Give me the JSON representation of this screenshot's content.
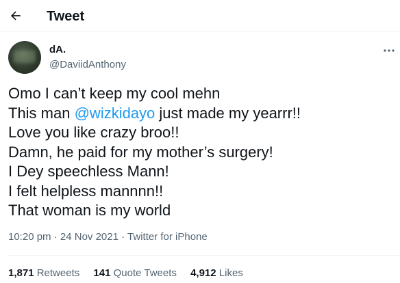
{
  "header": {
    "back_icon": "arrow-left-icon",
    "title": "Tweet"
  },
  "author": {
    "display_name": "dA.",
    "handle": "@DaviidAnthony",
    "more_icon": "more-horizontal-icon"
  },
  "tweet": {
    "lines": [
      {
        "before": "Omo I can’t keep my cool mehn"
      },
      {
        "before": "This man ",
        "mention": "@wizkidayo",
        "after": " just made my yearrr!!"
      },
      {
        "before": "Love you like crazy broo!!"
      },
      {
        "before": "Damn, he paid for my mother’s surgery!"
      },
      {
        "before": "I Dey speechless Mann!"
      },
      {
        "before": "I felt helpless mannnn!!"
      },
      {
        "before": "That woman is my world"
      }
    ]
  },
  "meta": {
    "time": "10:20 pm",
    "separator": "·",
    "date": "24 Nov 2021",
    "source": "Twitter for iPhone"
  },
  "stats": {
    "retweets_count": "1,871",
    "retweets_label": "Retweets",
    "quotes_count": "141",
    "quotes_label": "Quote Tweets",
    "likes_count": "4,912",
    "likes_label": "Likes"
  },
  "colors": {
    "accent": "#1d9bf0",
    "secondary_text": "#536471",
    "primary_text": "#0f1419",
    "divider": "#eff3f4"
  }
}
